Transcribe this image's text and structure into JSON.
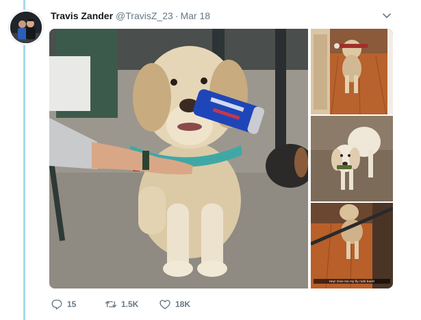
{
  "tweet": {
    "author_name": "Travis Zander",
    "author_handle": "@TravisZ_23",
    "separator": "·",
    "date": "Mar 18"
  },
  "media": {
    "caption": "Hey! Give me my fly rods back!"
  },
  "actions": {
    "reply_count": "15",
    "retweet_count": "1.5K",
    "like_count": "18K"
  },
  "colors": {
    "thread_line": "#a4d9ea",
    "muted_text": "#657786",
    "primary_text": "#14171a"
  },
  "icons": {
    "reply": "reply-icon",
    "retweet": "retweet-icon",
    "like": "heart-icon",
    "menu": "chevron-down-icon"
  }
}
